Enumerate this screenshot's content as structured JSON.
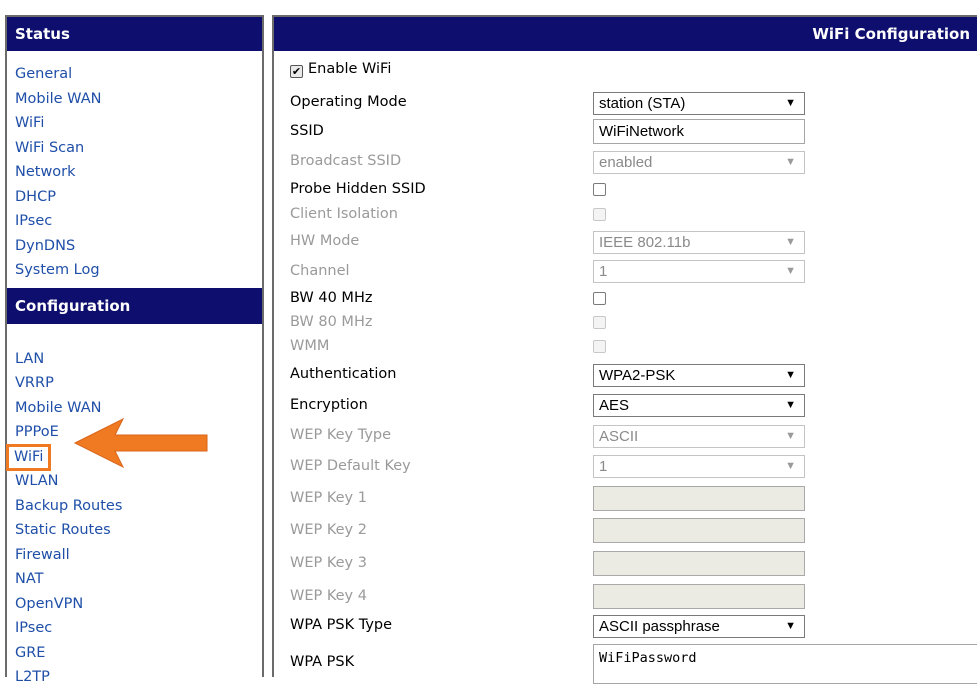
{
  "sidebar": {
    "status_header": "Status",
    "status_items": [
      "General",
      "Mobile WAN",
      "WiFi",
      "WiFi Scan",
      "Network",
      "DHCP",
      "IPsec",
      "DynDNS",
      "System Log"
    ],
    "config_header": "Configuration",
    "config_items": [
      "LAN",
      "VRRP",
      "Mobile WAN",
      "PPPoE",
      "WiFi",
      "WLAN",
      "Backup Routes",
      "Static Routes",
      "Firewall",
      "NAT",
      "OpenVPN",
      "IPsec",
      "GRE",
      "L2TP"
    ],
    "highlighted_item": "WiFi",
    "highlight_color": "#f07a22"
  },
  "main": {
    "title": "WiFi Configuration",
    "enable_wifi": {
      "label": "Enable WiFi",
      "checked": true
    },
    "fields": {
      "operating_mode": {
        "label": "Operating Mode",
        "value": "station (STA)"
      },
      "ssid": {
        "label": "SSID",
        "value": "WiFiNetwork"
      },
      "broadcast_ssid": {
        "label": "Broadcast SSID",
        "value": "enabled"
      },
      "probe_hidden_ssid": {
        "label": "Probe Hidden SSID"
      },
      "client_isolation": {
        "label": "Client Isolation"
      },
      "hw_mode": {
        "label": "HW Mode",
        "value": "IEEE 802.11b"
      },
      "channel": {
        "label": "Channel",
        "value": "1"
      },
      "bw40": {
        "label": "BW 40 MHz"
      },
      "bw80": {
        "label": "BW 80 MHz"
      },
      "wmm": {
        "label": "WMM"
      },
      "authentication": {
        "label": "Authentication",
        "value": "WPA2-PSK"
      },
      "encryption": {
        "label": "Encryption",
        "value": "AES"
      },
      "wep_key_type": {
        "label": "WEP Key Type",
        "value": "ASCII"
      },
      "wep_default_key": {
        "label": "WEP Default Key",
        "value": "1"
      },
      "wep_key_1": {
        "label": "WEP Key 1"
      },
      "wep_key_2": {
        "label": "WEP Key 2"
      },
      "wep_key_3": {
        "label": "WEP Key 3"
      },
      "wep_key_4": {
        "label": "WEP Key 4"
      },
      "wpa_psk_type": {
        "label": "WPA PSK Type",
        "value": "ASCII passphrase"
      },
      "wpa_psk": {
        "label": "WPA PSK",
        "value": "WiFiPassword"
      }
    }
  },
  "colors": {
    "header_bg": "#0e0e6e",
    "link": "#1f4fa8",
    "disabled_text": "#9a9a9a"
  },
  "icons": {
    "dropdown": "dropdown-arrow-icon",
    "pointer": "arrow-pointer-icon"
  }
}
